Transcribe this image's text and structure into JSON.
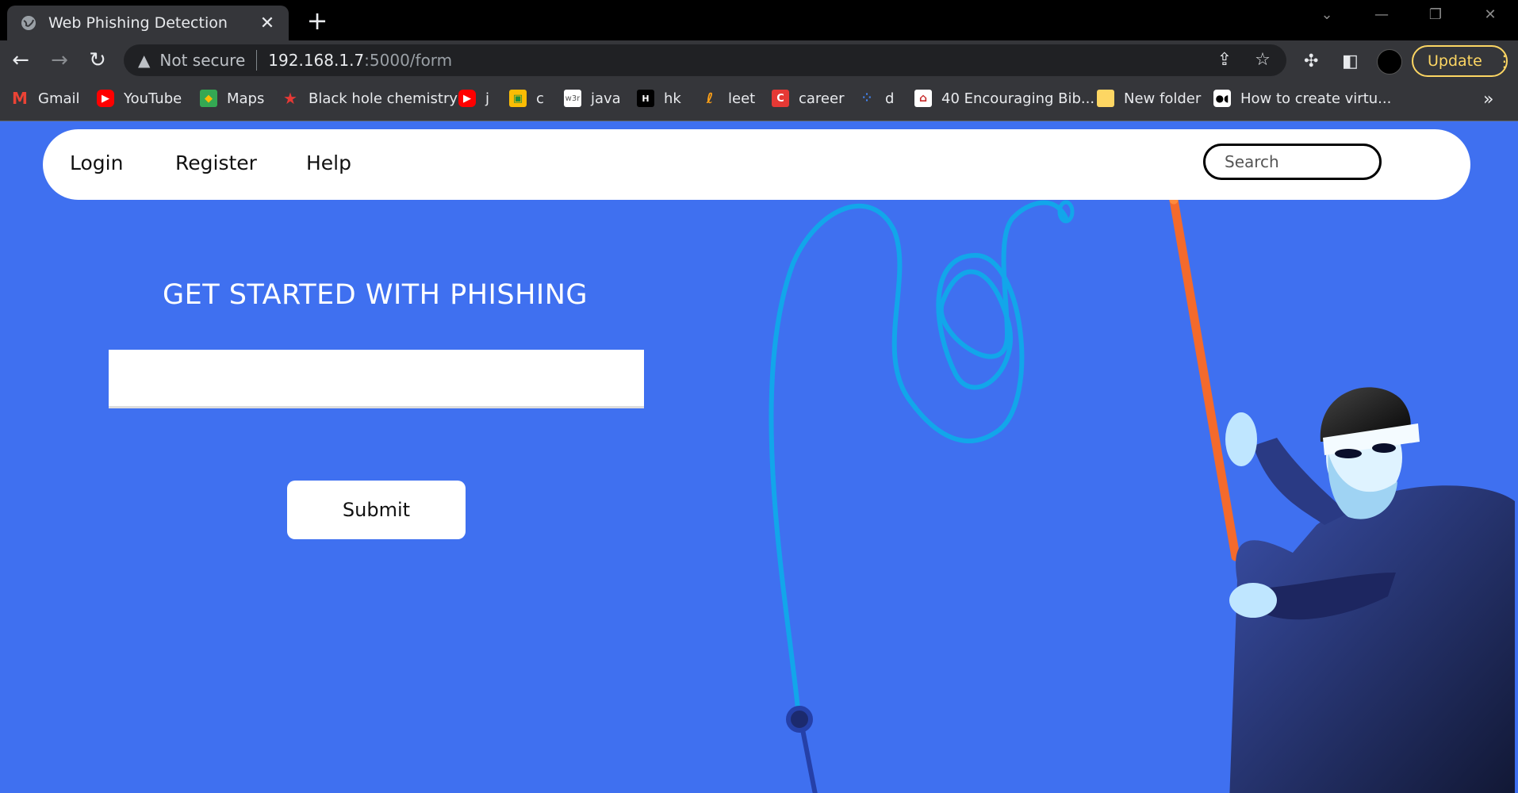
{
  "browser": {
    "tab_title": "Web Phishing Detection",
    "new_tab_symbol": "+",
    "close_symbol": "✕",
    "security_label": "Not secure",
    "url_host": "192.168.1.7",
    "url_rest": ":5000/form",
    "update_label": "Update",
    "bookmarks": [
      {
        "label": "Gmail",
        "icon": "gmail-icon"
      },
      {
        "label": "YouTube",
        "icon": "youtube-icon"
      },
      {
        "label": "Maps",
        "icon": "maps-icon"
      },
      {
        "label": "Black hole chemistry",
        "icon": "star-icon"
      },
      {
        "label": "j",
        "icon": "youtube-icon"
      },
      {
        "label": "c",
        "icon": "classroom-icon"
      },
      {
        "label": "java",
        "icon": "w3schools-icon"
      },
      {
        "label": "hk",
        "icon": "hackerrank-icon"
      },
      {
        "label": "leet",
        "icon": "leetcode-icon"
      },
      {
        "label": "career",
        "icon": "career-icon"
      },
      {
        "label": "d",
        "icon": "dots-icon"
      },
      {
        "label": "40 Encouraging Bib...",
        "icon": "family-icon"
      },
      {
        "label": "New folder",
        "icon": "folder-icon"
      },
      {
        "label": "How to create virtu...",
        "icon": "medium-icon"
      }
    ],
    "more_symbol": "»"
  },
  "nav": {
    "login": "Login",
    "register": "Register",
    "help": "Help",
    "search_placeholder": "Search"
  },
  "main": {
    "heading": "GET STARTED WITH PHISHING",
    "url_input_value": "",
    "submit_label": "Submit"
  },
  "colors": {
    "page_background": "#3f70f0",
    "fishing_line": "#1aa8e8",
    "rod": "#f46a2c",
    "thief_body": "#1f2a5c"
  }
}
